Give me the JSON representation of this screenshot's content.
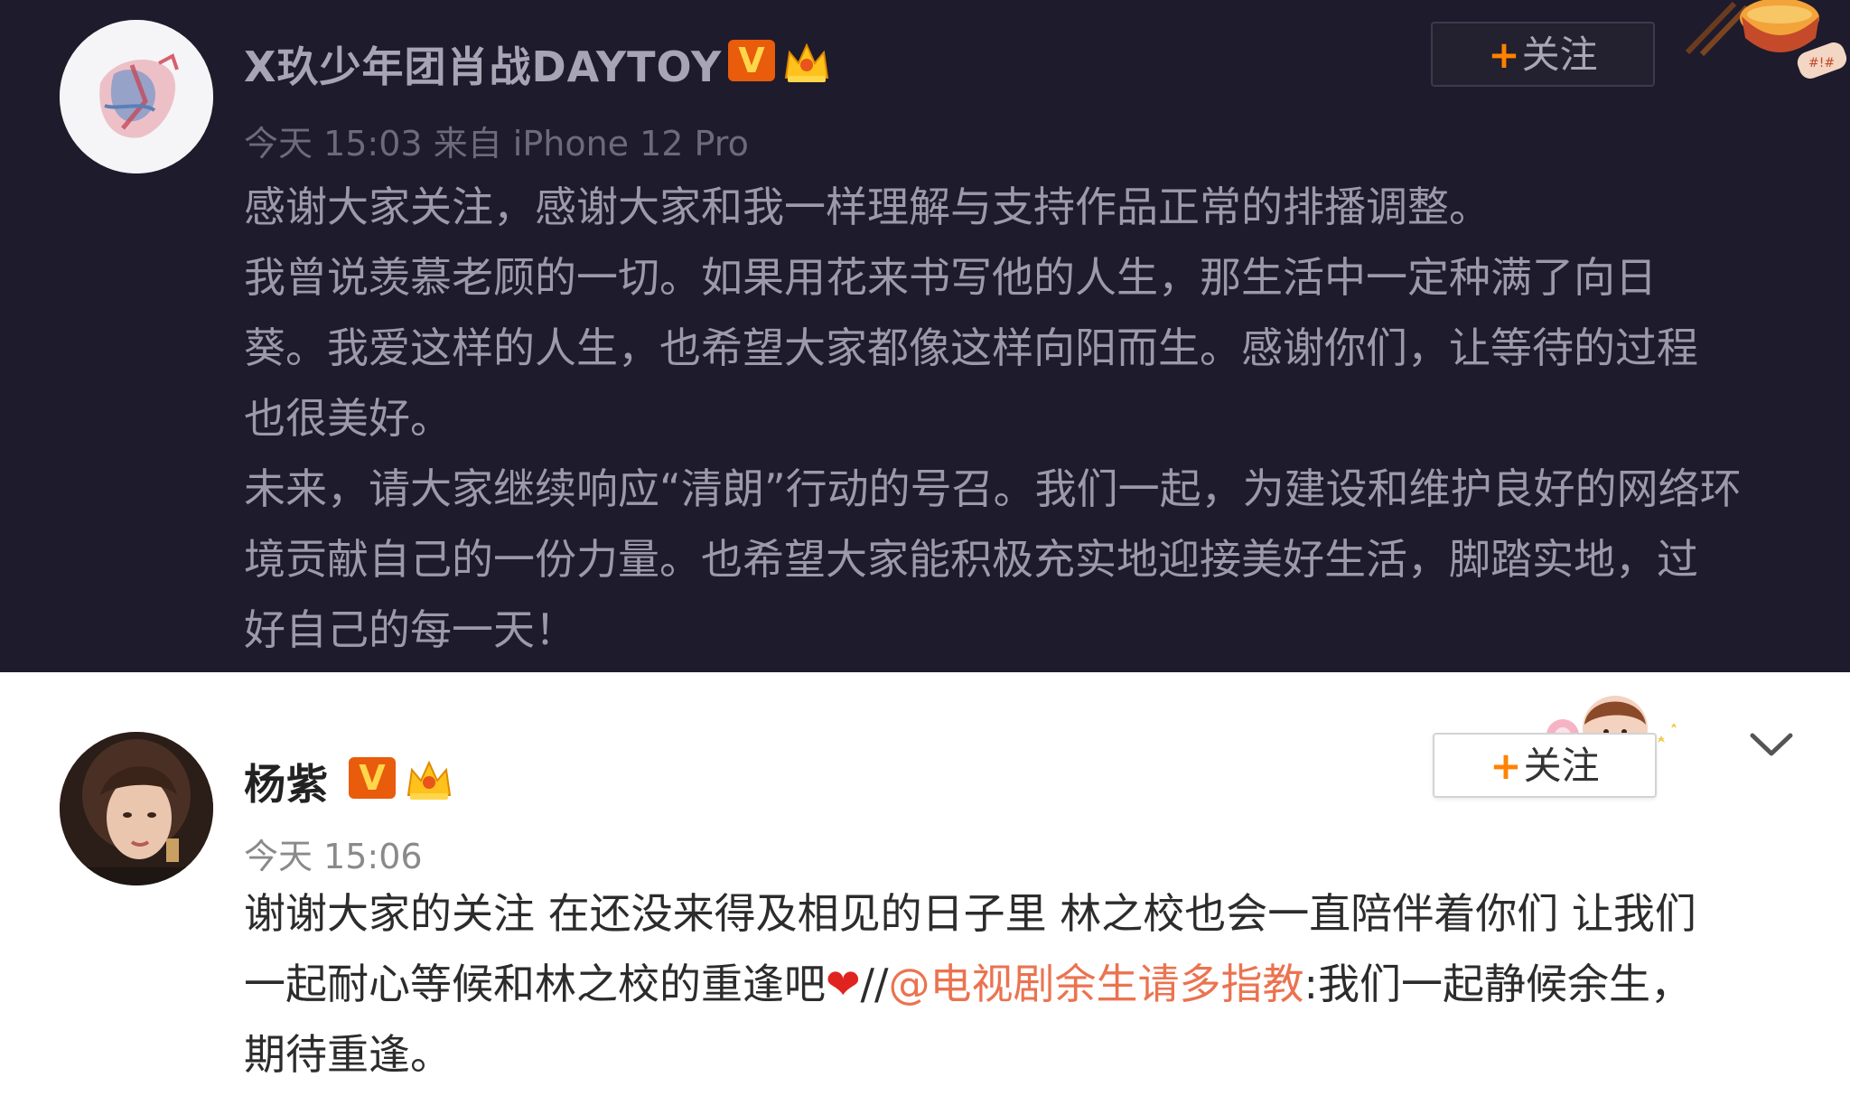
{
  "post1": {
    "username": "X玖少年团肖战DAYTOY",
    "vip_badge": "V",
    "time": "今天 15:03",
    "source": "来自 iPhone 12 Pro",
    "follow_label": "关注",
    "follow_plus": "+",
    "lines": [
      "感谢大家关注，感谢大家和我一样理解与支持作品正常的排播调整。",
      "我曾说羡慕老顾的一切。如果用花来书写他的人生，那生活中一定种满了向日",
      "葵。我爱这样的人生，也希望大家都像这样向阳而生。感谢你们，让等待的过程",
      "也很美好。",
      "未来，请大家继续响应“清朗”行动的号召。我们一起，为建设和维护良好的网络环",
      "境贡献自己的一份力量。也希望大家能积极充实地迎接美好生活，脚踏实地，过",
      "好自己的每一天！"
    ]
  },
  "post2": {
    "username": "杨紫",
    "vip_badge": "V",
    "time": "今天 15:06",
    "follow_label": "关注",
    "follow_plus": "+",
    "line1": "谢谢大家的关注  在还没来得及相见的日子里 林之校也会一直陪伴着你们 让我们",
    "line2_before": "一起耐心等候和林之校的重逢吧",
    "heart": "❤",
    "line2_slashes": "//",
    "mention": "@电视剧余生请多指教",
    "line2_after": ":我们一起静候余生，",
    "line3": "期待重逢。"
  },
  "colors": {
    "dark_bg": "#1e1b2c",
    "vip_orange": "#e85c0c",
    "follow_plus": "#ff8200",
    "mention": "#eb7350"
  },
  "icons": [
    "crown-badge-icon",
    "chevron-down-icon",
    "noodle-bowl-decoration",
    "avatar-sticker-decoration"
  ]
}
